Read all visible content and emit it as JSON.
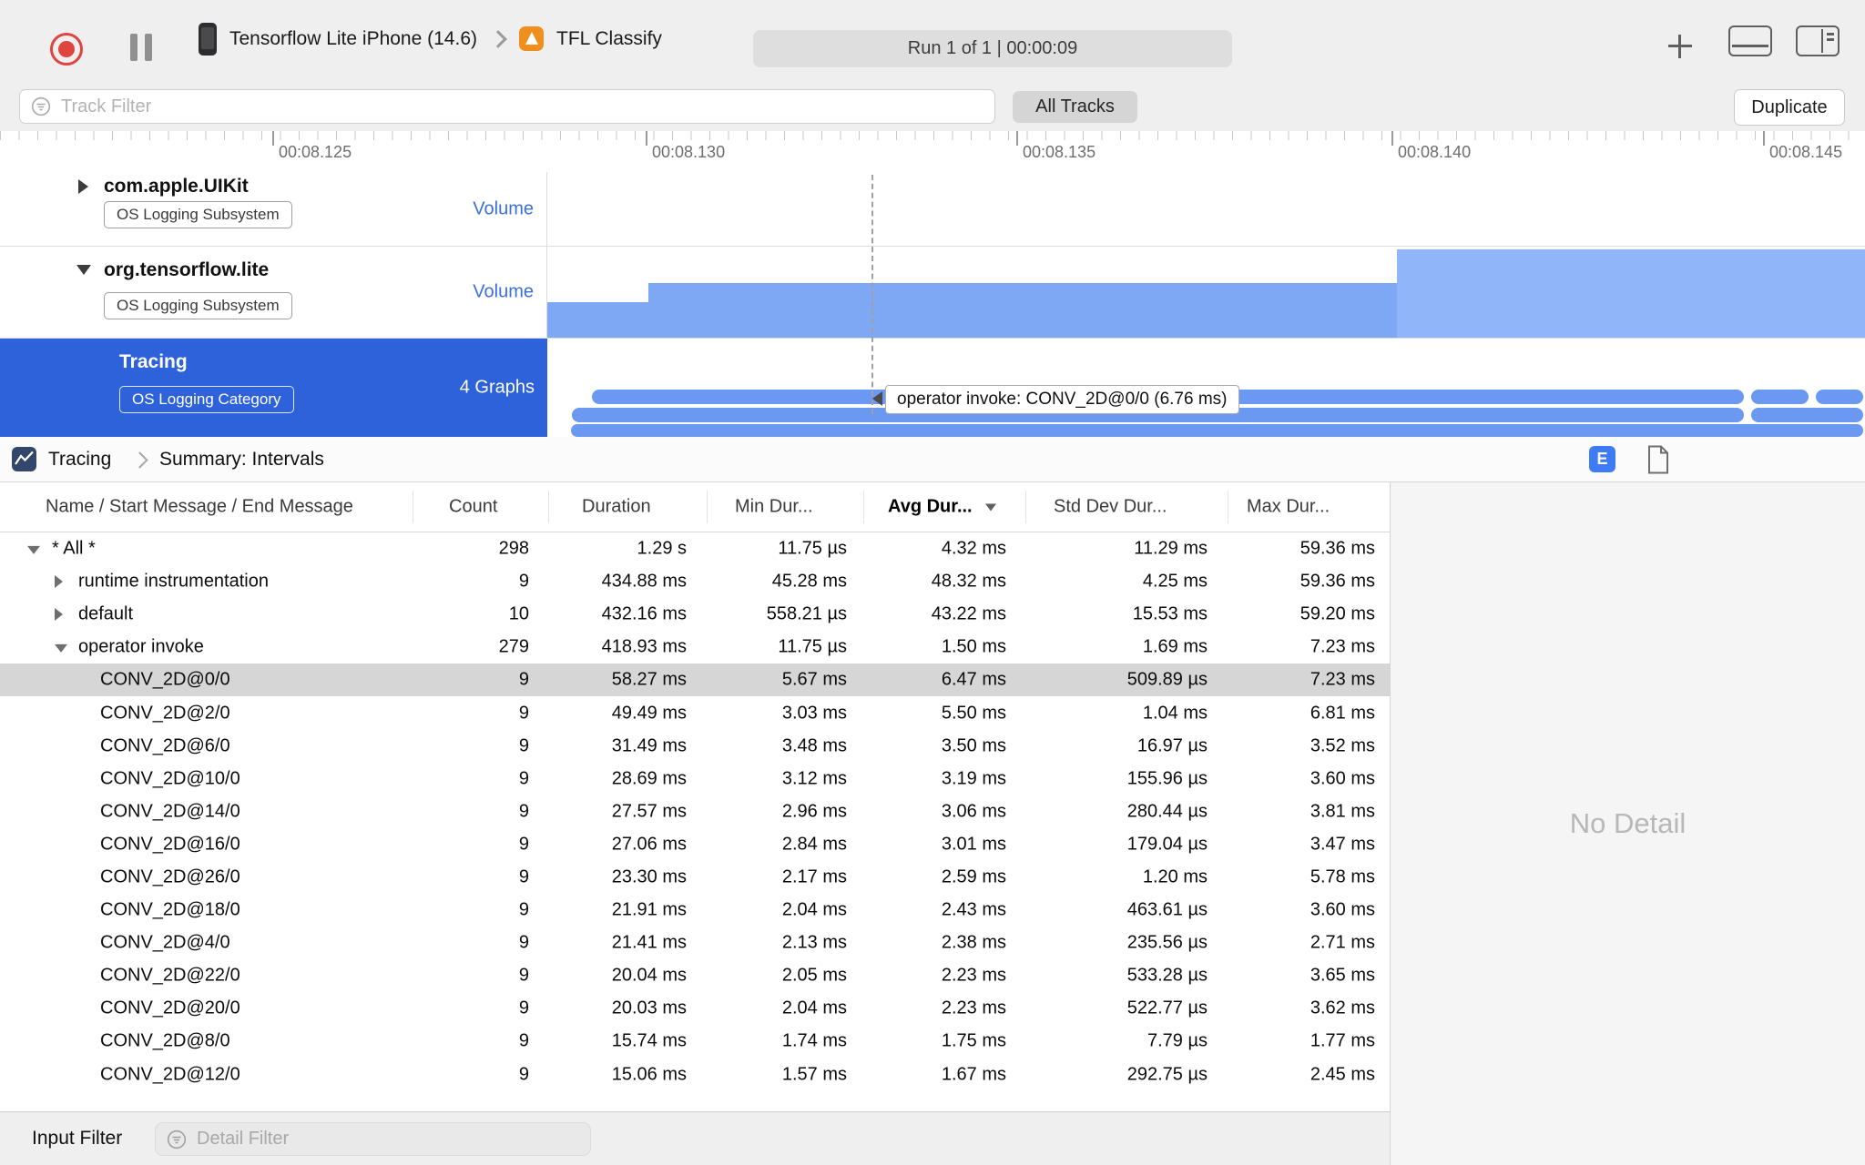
{
  "toolbar": {
    "device_label": "Tensorflow Lite iPhone (14.6)",
    "app_label": "TFL Classify",
    "status": "Run 1 of 1  |  00:00:09"
  },
  "filter_bar": {
    "track_filter_placeholder": "Track Filter",
    "all_tracks_label": "All Tracks",
    "duplicate_label": "Duplicate"
  },
  "ruler": {
    "labels": [
      "00:08.125",
      "00:08.130",
      "00:08.135",
      "00:08.140",
      "00:08.145"
    ]
  },
  "tracks": [
    {
      "title": "com.apple.UIKit",
      "badge": "OS Logging Subsystem",
      "meta": "Volume"
    },
    {
      "title": "org.tensorflow.lite",
      "badge": "OS Logging Subsystem",
      "meta": "Volume"
    },
    {
      "title": "Tracing",
      "badge": "OS Logging Category",
      "meta": "4 Graphs",
      "selected": true
    }
  ],
  "tracks_area": {
    "tooltip": "operator invoke: CONV_2D@0/0 (6.76 ms)"
  },
  "breadcrumb": {
    "first": "Tracing",
    "second": "Summary: Intervals"
  },
  "detail_buttons": {
    "e_label": "E"
  },
  "table": {
    "columns": [
      "Name / Start Message / End Message",
      "Count",
      "Duration",
      "Min Dur...",
      "Avg Dur...",
      "Std Dev Dur...",
      "Max Dur..."
    ],
    "rows": [
      {
        "level": 1,
        "disc": "down",
        "name": "* All *",
        "count": "298",
        "duration": "1.29 s",
        "min": "11.75 µs",
        "avg": "4.32 ms",
        "std": "11.29 ms",
        "max": "59.36 ms"
      },
      {
        "level": 2,
        "disc": "right",
        "name": "runtime instrumentation",
        "count": "9",
        "duration": "434.88 ms",
        "min": "45.28 ms",
        "avg": "48.32 ms",
        "std": "4.25 ms",
        "max": "59.36 ms"
      },
      {
        "level": 2,
        "disc": "right",
        "name": "default",
        "count": "10",
        "duration": "432.16 ms",
        "min": "558.21 µs",
        "avg": "43.22 ms",
        "std": "15.53 ms",
        "max": "59.20 ms"
      },
      {
        "level": 2,
        "disc": "down",
        "name": "operator invoke",
        "count": "279",
        "duration": "418.93 ms",
        "min": "11.75 µs",
        "avg": "1.50 ms",
        "std": "1.69 ms",
        "max": "7.23 ms"
      },
      {
        "level": 3,
        "selected": true,
        "name": "CONV_2D@0/0",
        "count": "9",
        "duration": "58.27 ms",
        "min": "5.67 ms",
        "avg": "6.47 ms",
        "std": "509.89 µs",
        "max": "7.23 ms"
      },
      {
        "level": 3,
        "name": "CONV_2D@2/0",
        "count": "9",
        "duration": "49.49 ms",
        "min": "3.03 ms",
        "avg": "5.50 ms",
        "std": "1.04 ms",
        "max": "6.81 ms"
      },
      {
        "level": 3,
        "name": "CONV_2D@6/0",
        "count": "9",
        "duration": "31.49 ms",
        "min": "3.48 ms",
        "avg": "3.50 ms",
        "std": "16.97 µs",
        "max": "3.52 ms"
      },
      {
        "level": 3,
        "name": "CONV_2D@10/0",
        "count": "9",
        "duration": "28.69 ms",
        "min": "3.12 ms",
        "avg": "3.19 ms",
        "std": "155.96 µs",
        "max": "3.60 ms"
      },
      {
        "level": 3,
        "name": "CONV_2D@14/0",
        "count": "9",
        "duration": "27.57 ms",
        "min": "2.96 ms",
        "avg": "3.06 ms",
        "std": "280.44 µs",
        "max": "3.81 ms"
      },
      {
        "level": 3,
        "name": "CONV_2D@16/0",
        "count": "9",
        "duration": "27.06 ms",
        "min": "2.84 ms",
        "avg": "3.01 ms",
        "std": "179.04 µs",
        "max": "3.47 ms"
      },
      {
        "level": 3,
        "name": "CONV_2D@26/0",
        "count": "9",
        "duration": "23.30 ms",
        "min": "2.17 ms",
        "avg": "2.59 ms",
        "std": "1.20 ms",
        "max": "5.78 ms"
      },
      {
        "level": 3,
        "name": "CONV_2D@18/0",
        "count": "9",
        "duration": "21.91 ms",
        "min": "2.04 ms",
        "avg": "2.43 ms",
        "std": "463.61 µs",
        "max": "3.60 ms"
      },
      {
        "level": 3,
        "name": "CONV_2D@4/0",
        "count": "9",
        "duration": "21.41 ms",
        "min": "2.13 ms",
        "avg": "2.38 ms",
        "std": "235.56 µs",
        "max": "2.71 ms"
      },
      {
        "level": 3,
        "name": "CONV_2D@22/0",
        "count": "9",
        "duration": "20.04 ms",
        "min": "2.05 ms",
        "avg": "2.23 ms",
        "std": "533.28 µs",
        "max": "3.65 ms"
      },
      {
        "level": 3,
        "name": "CONV_2D@20/0",
        "count": "9",
        "duration": "20.03 ms",
        "min": "2.04 ms",
        "avg": "2.23 ms",
        "std": "522.77 µs",
        "max": "3.62 ms"
      },
      {
        "level": 3,
        "name": "CONV_2D@8/0",
        "count": "9",
        "duration": "15.74 ms",
        "min": "1.74 ms",
        "avg": "1.75 ms",
        "std": "7.79 µs",
        "max": "1.77 ms"
      },
      {
        "level": 3,
        "name": "CONV_2D@12/0",
        "count": "9",
        "duration": "15.06 ms",
        "min": "1.57 ms",
        "avg": "1.67 ms",
        "std": "292.75 µs",
        "max": "2.45 ms"
      }
    ]
  },
  "right_panel": {
    "empty_text": "No Detail"
  },
  "footer": {
    "label": "Input Filter",
    "detail_filter_placeholder": "Detail Filter"
  },
  "colors": {
    "selection_blue": "#2d62da",
    "volume_blue": "#7ea8f4",
    "volume_blue_light": "#90b5f8",
    "interval_blue": "#6b99f2",
    "accent_blue_text": "#3a6fe0",
    "record_red": "#e0443f"
  }
}
